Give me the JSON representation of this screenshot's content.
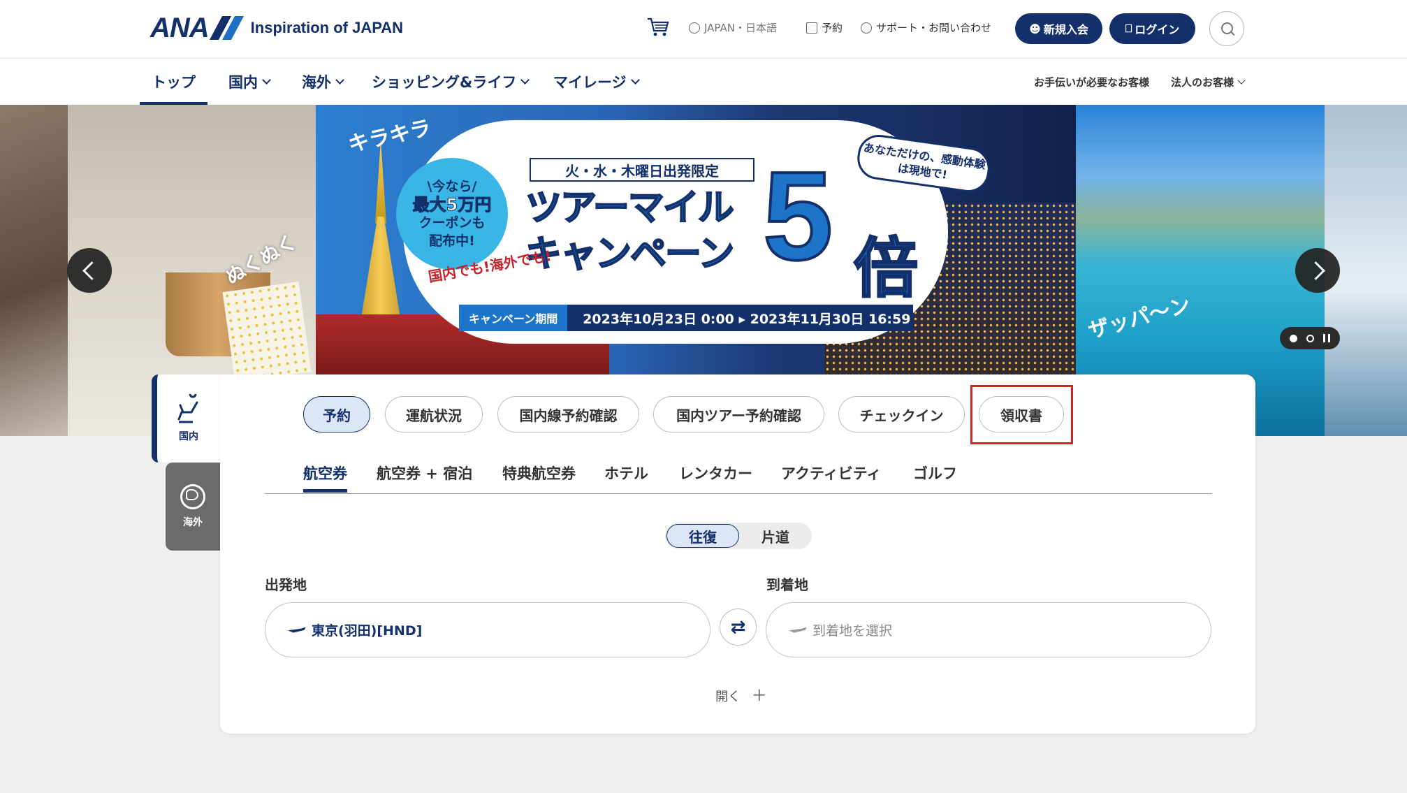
{
  "header": {
    "logo_ana": "ANA",
    "tagline": "Inspiration of JAPAN",
    "region": "JAPAN・日本語",
    "reserve": "予約",
    "support": "サポート・お問い合わせ",
    "signup": "新規入会",
    "login": "ログイン"
  },
  "mainnav": {
    "items": [
      {
        "label": "トップ"
      },
      {
        "label": "国内"
      },
      {
        "label": "海外"
      },
      {
        "label": "ショッピング&ライフ"
      },
      {
        "label": "マイレージ"
      }
    ],
    "assist": "お手伝いが必要なお客様",
    "corporate": "法人のお客様"
  },
  "hero": {
    "nukunuku": "ぬくぬく",
    "kira": "キラキラ",
    "badge": [
      "\\今なら/",
      "最大5万円",
      "クーポンも",
      "配布中!"
    ],
    "days": "火・水・木曜日出発限定",
    "title_line1": "ツアーマイル",
    "title_line2": "キャンペーン",
    "five": "5",
    "bai": "倍",
    "bubble": "あなただけの、感動体験は現地で!",
    "note": "国内でも!海外でも!",
    "period_label": "キャンペーン期間",
    "period": "2023年10月23日 0:00 ▸ 2023年11月30日 16:59",
    "zappan": "ザッパ〜ン"
  },
  "side": {
    "domestic": "国内",
    "international": "海外"
  },
  "booking": {
    "top_buttons": [
      {
        "label": "予約"
      },
      {
        "label": "運航状況"
      },
      {
        "label": "国内線予約確認"
      },
      {
        "label": "国内ツアー予約確認"
      },
      {
        "label": "チェックイン"
      },
      {
        "label": "領収書"
      }
    ],
    "subtabs": [
      {
        "label": "航空券"
      },
      {
        "label": "航空券 + 宿泊"
      },
      {
        "label": "特典航空券"
      },
      {
        "label": "ホテル"
      },
      {
        "label": "レンタカー"
      },
      {
        "label": "アクティビティ"
      },
      {
        "label": "ゴルフ"
      }
    ],
    "trip_round": "往復",
    "trip_oneway": "片道",
    "from_label": "出発地",
    "from_value": "東京(羽田)[HND]",
    "to_label": "到着地",
    "to_placeholder": "到着地を選択",
    "open": "開く",
    "open_plus": "＋"
  },
  "colors": {
    "brand": "#13306b",
    "highlight": "#d81f26"
  }
}
